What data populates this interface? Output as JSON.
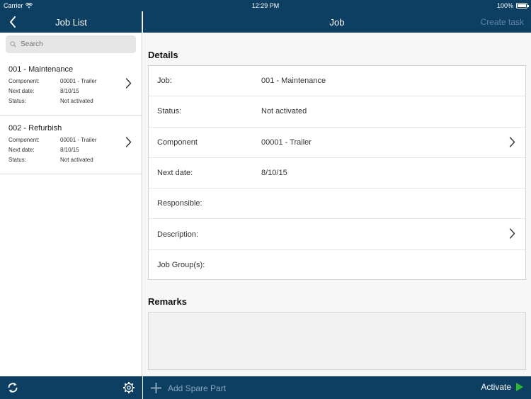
{
  "status_bar": {
    "carrier": "Carrier",
    "time": "12:29 PM",
    "battery": "100%"
  },
  "left_pane": {
    "title": "Job List",
    "search": {
      "placeholder": "Search",
      "value": ""
    },
    "jobs": [
      {
        "title": "001 - Maintenance",
        "component_label": "Component:",
        "component": "00001 - Trailer",
        "next_date_label": "Next date:",
        "next_date": "8/10/15",
        "status_label": "Status:",
        "status": "Not activated"
      },
      {
        "title": "002 - Refurbish",
        "component_label": "Component:",
        "component": "00001 - Trailer",
        "next_date_label": "Next date:",
        "next_date": "8/10/15",
        "status_label": "Status:",
        "status": "Not activated"
      }
    ]
  },
  "right_pane": {
    "title": "Job",
    "create_task": "Create task",
    "details_header": "Details",
    "details": [
      {
        "label": "Job:",
        "value": "001 - Maintenance"
      },
      {
        "label": "Status:",
        "value": "Not activated"
      },
      {
        "label": "Component",
        "value": "00001 - Trailer"
      },
      {
        "label": "Next date:",
        "value": "8/10/15"
      },
      {
        "label": "Responsible:",
        "value": ""
      },
      {
        "label": "Description:",
        "value": ""
      },
      {
        "label": "Job Group(s):",
        "value": ""
      }
    ],
    "remarks_header": "Remarks",
    "add_spare_part": "Add Spare Part",
    "activate": "Activate"
  },
  "colors": {
    "nav_bar": "#0d3f63",
    "activate_arrow": "#2eb82e"
  }
}
